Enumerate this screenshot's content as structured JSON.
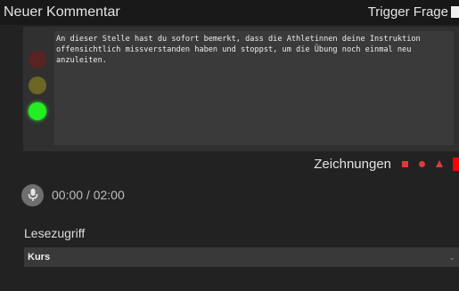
{
  "header": {
    "title": "Neuer Kommentar",
    "trigger_label": "Trigger Frage"
  },
  "rating_lights": {
    "states": [
      "red-off",
      "yellow-off",
      "green-on"
    ]
  },
  "comment": {
    "text": "An dieser Stelle hast du sofort bemerkt, dass die Athletinnen deine Instruktion offensichtlich missverstanden haben und stoppst, um die Übung noch einmal neu anzuleiten."
  },
  "drawings": {
    "label": "Zeichnungen",
    "tools": [
      "square-icon",
      "circle-icon",
      "arrow-icon",
      "rectangle-icon"
    ],
    "color": "#e03a3a"
  },
  "audio": {
    "time": "00:00 / 02:00"
  },
  "access": {
    "label": "Lesezugriff",
    "selected": "Kurs"
  },
  "colors": {
    "background": "#222222",
    "header": "#181818",
    "editor": "#3a3a3a",
    "green_light": "#22ee22",
    "accent_red": "#ff0000"
  }
}
